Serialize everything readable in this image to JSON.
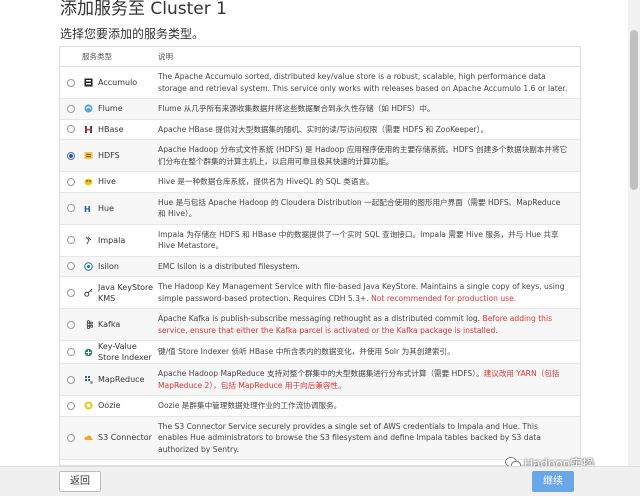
{
  "header": {
    "title": "添加服务至 Cluster 1",
    "subtitle": "选择您要添加的服务类型。"
  },
  "table": {
    "col_service": "服务类型",
    "col_desc": "说明",
    "rows": [
      {
        "name": "Accumulo",
        "icon": "accumulo-icon",
        "checked": false,
        "desc": "The Apache Accumulo sorted, distributed key/value store is a robust, scalable, high performance data storage and retrieval system. This service only works with releases based on Apache Accumulo 1.6 or later.",
        "warn": ""
      },
      {
        "name": "Flume",
        "icon": "flume-icon",
        "checked": false,
        "desc": "Flume 从几乎所有来源收集数据并将这些数据聚合到永久性存储（如 HDFS）中。",
        "warn": ""
      },
      {
        "name": "HBase",
        "icon": "hbase-icon",
        "checked": false,
        "desc": "Apache HBase 提供对大型数据集的随机、实时的读/写访问权限（需要 HDFS 和 ZooKeeper）。",
        "warn": ""
      },
      {
        "name": "HDFS",
        "icon": "hdfs-icon",
        "checked": true,
        "desc": "Apache Hadoop 分布式文件系统 (HDFS) 是 Hadoop 应用程序使用的主要存储系统。HDFS 创建多个数据块副本并将它们分布在整个群集的计算主机上，以启用可靠且极其快速的计算功能。",
        "warn": ""
      },
      {
        "name": "Hive",
        "icon": "hive-icon",
        "checked": false,
        "desc": "Hive 是一种数据仓库系统，提供名为 HiveQL 的 SQL 类语言。",
        "warn": ""
      },
      {
        "name": "Hue",
        "icon": "hue-icon",
        "checked": false,
        "desc": "Hue 是与包括 Apache Hadoop 的 Cloudera Distribution 一起配合使用的图形用户界面（需要 HDFS、MapReduce 和 Hive）。",
        "warn": ""
      },
      {
        "name": "Impala",
        "icon": "impala-icon",
        "checked": false,
        "desc": "Impala 为存储在 HDFS 和 HBase 中的数据提供了一个实时 SQL 查询接口。Impala 需要 Hive 服务，并与 Hue 共享 Hive Metastore。",
        "warn": ""
      },
      {
        "name": "Isilon",
        "icon": "isilon-icon",
        "checked": false,
        "desc": "EMC Isilon is a distributed filesystem.",
        "warn": ""
      },
      {
        "name": "Java KeyStore KMS",
        "icon": "key-icon",
        "checked": false,
        "desc": "The Hadoop Key Management Service with file-based Java KeyStore. Maintains a single copy of keys, using simple password-based protection. Requires CDH 5.3+. ",
        "warn": "Not recommended for production use."
      },
      {
        "name": "Kafka",
        "icon": "kafka-icon",
        "checked": false,
        "desc": "Apache Kafka is publish-subscribe messaging rethought as a distributed commit log. ",
        "warn": "Before adding this service, ensure that either the Kafka parcel is activated or the Kafka package is installed."
      },
      {
        "name": "Key-Value Store Indexer",
        "icon": "indexer-icon",
        "checked": false,
        "desc": "键/值 Store Indexer 侦听 HBase 中所含表内的数据变化，并使用 Solr 为其创建索引。",
        "warn": ""
      },
      {
        "name": "MapReduce",
        "icon": "mapreduce-icon",
        "checked": false,
        "desc": "Apache Hadoop MapReduce 支持对整个群集中的大型数据集进行分布式计算（需要 HDFS）。",
        "warn": "建议改用 YARN（包括 MapReduce 2），包括 MapReduce 用于向后兼容性。"
      },
      {
        "name": "Oozie",
        "icon": "oozie-icon",
        "checked": false,
        "desc": "Oozie 是群集中管理数据处理作业的工作流协调服务。",
        "warn": ""
      },
      {
        "name": "S3 Connector",
        "icon": "cloud-icon",
        "checked": false,
        "desc": "The S3 Connector Service securely provides a single set of AWS credentials to Impala and Hue. This enables Hue administrators to browse the S3 filesystem and define Impala tables backed by S3 data authorized by Sentry.",
        "warn": ""
      }
    ]
  },
  "footer": {
    "back_label": "返回",
    "continue_label": "继续"
  },
  "watermark": {
    "text": "Hadoop实操"
  },
  "colors": {
    "accent": "#6aa7e8",
    "warn": "#dd3333",
    "checked": "#2a5fa8"
  }
}
